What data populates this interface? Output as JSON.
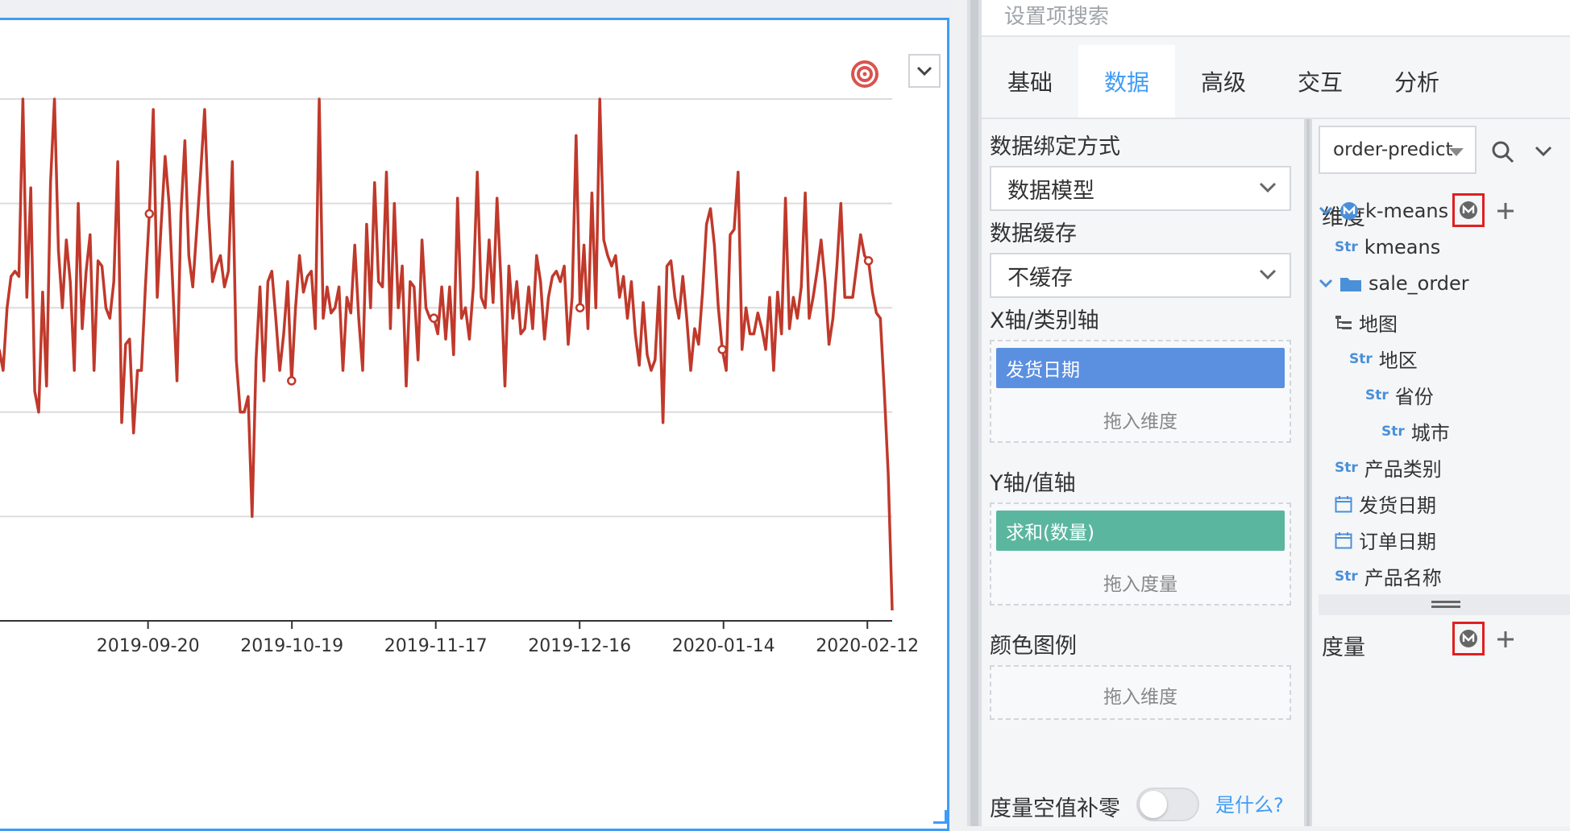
{
  "chart": {
    "x_tick_labels": [
      "2019-09-20",
      "2019-10-19",
      "2019-11-17",
      "2019-12-16",
      "2020-01-14",
      "2020-02-12"
    ]
  },
  "chart_data": {
    "type": "line",
    "series_color": "#c0392b",
    "grid": true,
    "x_ticks": [
      "2019-09-20",
      "2019-10-19",
      "2019-11-17",
      "2019-12-16",
      "2020-01-14",
      "2020-02-12"
    ],
    "x_range": [
      "2019-08-21",
      "2020-02-17"
    ],
    "y_range": [
      0,
      100
    ],
    "values": [
      52,
      48,
      60,
      66,
      67,
      66,
      100,
      62,
      83,
      44,
      40,
      63,
      45,
      84,
      100,
      71,
      60,
      73,
      65,
      48,
      80,
      56,
      67,
      74,
      48,
      69,
      68,
      60,
      58,
      65,
      88,
      38,
      53,
      54,
      36,
      48,
      48,
      64,
      78,
      98,
      62,
      76,
      89,
      80,
      63,
      46,
      78,
      92,
      70,
      64,
      75,
      86,
      98,
      78,
      65,
      68,
      70,
      64,
      67,
      88,
      50,
      40,
      40,
      43,
      20,
      50,
      64,
      46,
      65,
      67,
      58,
      48,
      55,
      65,
      46,
      60,
      70,
      63,
      66,
      67,
      56,
      100,
      58,
      64,
      59,
      60,
      64,
      48,
      62,
      59,
      72,
      58,
      48,
      76,
      60,
      84,
      65,
      64,
      86,
      56,
      80,
      60,
      68,
      45,
      65,
      64,
      50,
      73,
      60,
      58,
      58,
      55,
      64,
      54,
      64,
      51,
      81,
      58,
      60,
      54,
      64,
      86,
      62,
      60,
      73,
      61,
      81,
      65,
      45,
      68,
      58,
      65,
      55,
      56,
      64,
      56,
      70,
      65,
      54,
      62,
      66,
      67,
      65,
      68,
      53,
      62,
      93,
      60,
      72,
      56,
      82,
      60,
      100,
      73,
      70,
      68,
      70,
      62,
      66,
      58,
      65,
      55,
      49,
      61,
      51,
      48,
      50,
      64,
      38,
      68,
      69,
      62,
      58,
      66,
      58,
      48,
      56,
      53,
      63,
      76,
      79,
      72,
      60,
      52,
      48,
      74,
      75,
      86,
      52,
      60,
      55,
      55,
      59,
      56,
      52,
      62,
      48,
      63,
      55,
      81,
      56,
      62,
      58,
      64,
      82,
      58,
      62,
      67,
      73,
      65,
      53,
      58,
      68,
      80,
      62,
      62,
      62,
      68,
      74,
      70,
      69,
      63,
      59,
      58,
      44,
      28,
      2
    ]
  },
  "search": {
    "placeholder": "设置项搜索"
  },
  "tabs": [
    "基础",
    "数据",
    "高级",
    "交互",
    "分析"
  ],
  "data_settings": {
    "binding_label": "数据绑定方式",
    "binding_value": "数据模型",
    "cache_label": "数据缓存",
    "cache_value": "不缓存",
    "x_axis_label": "X轴/类别轴",
    "x_axis_field": "发货日期",
    "x_axis_hint": "拖入维度",
    "y_axis_label": "Y轴/值轴",
    "y_axis_field": "求和(数量)",
    "y_axis_hint": "拖入度量",
    "color_label": "颜色图例",
    "color_hint": "拖入维度",
    "zero_fill_label": "度量空值补零",
    "whats_this": "是什么?"
  },
  "colors": {
    "accent": "#3f9bf6",
    "x_pill": "#5b8fe0",
    "y_pill": "#5bb6a0",
    "line": "#c0392b",
    "highlight": "#e0201f"
  },
  "model": {
    "selected": "order-predict",
    "dimension_label": "维度",
    "measure_label": "度量",
    "tree": [
      {
        "label": "k-means",
        "icon": "model-icon",
        "level": 0,
        "expandable": true
      },
      {
        "label": "kmeans",
        "icon": "str",
        "level": 1
      },
      {
        "label": "sale_order",
        "icon": "folder-icon",
        "level": 0,
        "expandable": true
      },
      {
        "label": "地图",
        "icon": "hierarchy-icon",
        "level": 1
      },
      {
        "label": "地区",
        "icon": "str",
        "level": 2
      },
      {
        "label": "省份",
        "icon": "str",
        "level": 3
      },
      {
        "label": "城市",
        "icon": "str",
        "level": 4
      },
      {
        "label": "产品类别",
        "icon": "str",
        "level": 1
      },
      {
        "label": "发货日期",
        "icon": "calendar-icon",
        "level": 1
      },
      {
        "label": "订单日期",
        "icon": "calendar-icon",
        "level": 1
      },
      {
        "label": "产品名称",
        "icon": "str",
        "level": 1
      }
    ],
    "str_tag": "Str"
  }
}
